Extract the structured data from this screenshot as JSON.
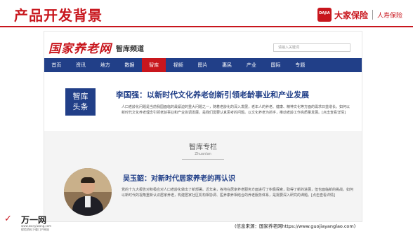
{
  "slide": {
    "title": "产品开发背景"
  },
  "brand": {
    "logo_text": "DAJIA",
    "name": "大家保险",
    "sub": "人寿保险"
  },
  "site": {
    "logo_text": "国家养老网",
    "channel": "智库频道",
    "search_placeholder": "请输入关键词"
  },
  "nav": [
    "首页",
    "资讯",
    "地方",
    "数据",
    "智库",
    "视频",
    "图片",
    "惠民",
    "产业",
    "国际",
    "专题"
  ],
  "feature": {
    "tag_line1": "智库",
    "tag_line2": "头条",
    "title": "李国强：以新时代文化养老创新引领老龄事业和产业发展",
    "body": "人口老龄化问题是当前我国面临的最紧迫的重大问题之一，随着老龄化的深入发展，老年人的养老、健康、精神文化等方面的需求日益增长。如何以新时代文化养老理念引领老龄事业和产业协调发展，是我们需要认真思考的问题。以文化养老为抓手，推动老龄工作高质量发展。[点击查看详情]"
  },
  "column": {
    "title": "智库专栏",
    "subtitle": "Zhuanlan",
    "article_title": "吴玉韶：对新时代居家养老的再认识",
    "body": "党的十九大报告对积极应对人口老龄化做出了新部署。近年来，各地在居家养老服务方面进行了积极探索，取得了新的进展，但也面临新的挑战。如何以新时代的视角重新认识居家养老，构建居家社区机构相协调、医养康养相结合的养老服务体系，是需要深入研究的课题。[点击查看详情]"
  },
  "footer": {
    "logo_mark": "✓",
    "logo_name": "万一网",
    "logo_url": "www.wanyiwang.com",
    "logo_slogan": "保险资料下载门户网站",
    "source": "(信息来源：国家养老网https://www.guojiayanglao.com)"
  },
  "colors": {
    "brand_red": "#c8161d",
    "nav_blue": "#213f88"
  }
}
